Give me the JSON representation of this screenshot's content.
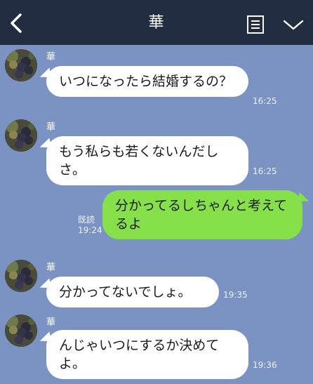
{
  "header": {
    "title": "華",
    "back_icon": "chevron-left-icon",
    "notes_icon": "notes-icon",
    "menu_icon": "chevron-down-icon"
  },
  "colors": {
    "header_bg": "#232d42",
    "chat_bg": "#7b93c2",
    "incoming_bubble": "#ffffff",
    "outgoing_bubble": "#85e04a"
  },
  "messages": [
    {
      "sender": "華",
      "text": "いつになったら結婚するの？",
      "time": "16:25",
      "direction": "in"
    },
    {
      "sender": "華",
      "text": "もう私らも若くないんだしさ。",
      "time": "16:25",
      "direction": "in"
    },
    {
      "text": "分かってるしちゃんと考えてるよ",
      "time": "19:24",
      "read": "既読",
      "direction": "out"
    },
    {
      "sender": "華",
      "text": "分かってないでしょ。",
      "time": "19:35",
      "direction": "in"
    },
    {
      "sender": "華",
      "text": "んじゃいつにするか決めてよ。",
      "time": "19:36",
      "direction": "in"
    }
  ]
}
